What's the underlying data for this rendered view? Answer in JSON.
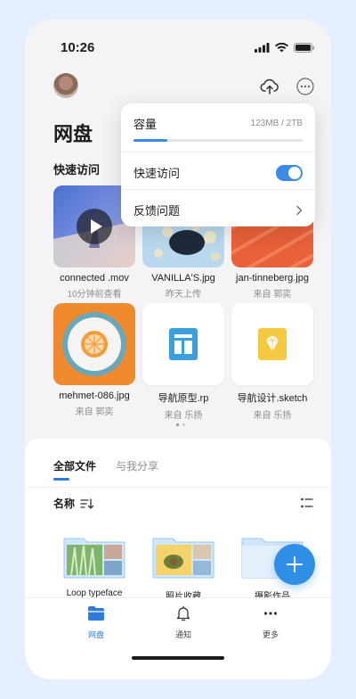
{
  "status_bar": {
    "time": "10:26"
  },
  "header": {
    "title": "网盘",
    "upload_icon": "cloud-upload-icon",
    "more_icon": "ellipsis-circle-icon"
  },
  "quick_access": {
    "title": "快速访问",
    "items": [
      {
        "name": "connected .mov",
        "sub": "10分钟前查看",
        "kind": "video"
      },
      {
        "name": "VANILLA'S.jpg",
        "sub": "昨天上传",
        "kind": "image"
      },
      {
        "name": "jan-tinneberg.jpg",
        "sub": "来自 郭奕",
        "kind": "image"
      },
      {
        "name": "mehmet-086.jpg",
        "sub": "来自 郭奕",
        "kind": "image"
      },
      {
        "name": "导航原型.rp",
        "sub": "来自 乐扬",
        "kind": "rp"
      },
      {
        "name": "导航设计.sketch",
        "sub": "来自 乐扬",
        "kind": "sketch"
      }
    ],
    "page_index": 1,
    "page_count": 2
  },
  "files": {
    "tabs": [
      {
        "label": "全部文件",
        "active": true
      },
      {
        "label": "与我分享",
        "active": false
      }
    ],
    "sort_label": "名称",
    "folders": [
      {
        "name": "Loop typeface"
      },
      {
        "name": "照片收藏"
      },
      {
        "name": "摄影作品"
      }
    ]
  },
  "tab_bar": [
    {
      "label": "网盘",
      "icon": "folder-icon",
      "active": true
    },
    {
      "label": "通知",
      "icon": "bell-icon",
      "active": false
    },
    {
      "label": "更多",
      "icon": "more-dots-icon",
      "active": false
    }
  ],
  "popover": {
    "capacity_label": "容量",
    "capacity_value": "123MB / 2TB",
    "capacity_fraction": 0.2,
    "quick_access_label": "快速访问",
    "quick_access_on": true,
    "feedback_label": "反馈问题"
  },
  "colors": {
    "accent": "#2f7bd9",
    "fab": "#2f8ee6",
    "background": "#e4efff"
  }
}
